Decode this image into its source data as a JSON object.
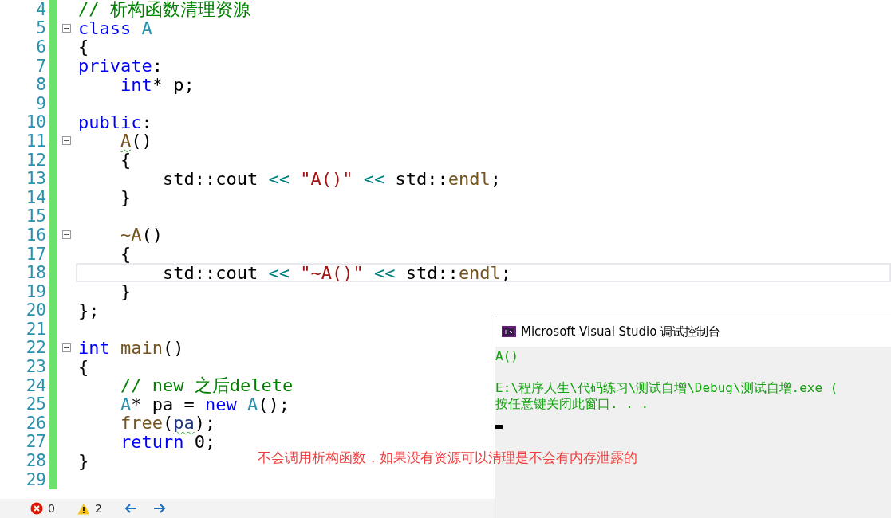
{
  "editor": {
    "lines": [
      {
        "number": "4",
        "tokens": [
          {
            "text": "// 析构函数清理资源",
            "kind": "comment"
          }
        ]
      },
      {
        "number": "5",
        "fold": true,
        "tokens": [
          {
            "text": "class",
            "kind": "keyword"
          },
          {
            "text": " A",
            "kind": "type"
          }
        ]
      },
      {
        "number": "6",
        "tokens": [
          {
            "text": "{"
          }
        ]
      },
      {
        "number": "7",
        "tokens": [
          {
            "text": "private",
            "kind": "keyword"
          },
          {
            "text": ":"
          }
        ]
      },
      {
        "number": "8",
        "tokens": [
          {
            "text": "    int",
            "kind": "keyword"
          },
          {
            "text": "* p;"
          }
        ]
      },
      {
        "number": "9"
      },
      {
        "number": "10",
        "tokens": [
          {
            "text": "public",
            "kind": "keyword"
          },
          {
            "text": ":"
          }
        ]
      },
      {
        "number": "11",
        "fold": true,
        "tokens": [
          {
            "text": "    A",
            "kind": "function",
            "squiggle": true
          },
          {
            "text": "()"
          }
        ]
      },
      {
        "number": "12",
        "tokens": [
          {
            "text": "    {"
          }
        ]
      },
      {
        "number": "13",
        "tokens": [
          {
            "text": "        std::cout "
          },
          {
            "text": "<< ",
            "kind": "operator"
          },
          {
            "text": "\"A()\" ",
            "kind": "string"
          },
          {
            "text": "<< ",
            "kind": "operator"
          },
          {
            "text": "std::"
          },
          {
            "text": "endl",
            "kind": "function"
          },
          {
            "text": ";"
          }
        ]
      },
      {
        "number": "14",
        "tokens": [
          {
            "text": "    }"
          }
        ]
      },
      {
        "number": "15"
      },
      {
        "number": "16",
        "fold": true,
        "tokens": [
          {
            "text": "    ~A",
            "kind": "function"
          },
          {
            "text": "()"
          }
        ]
      },
      {
        "number": "17",
        "tokens": [
          {
            "text": "    {"
          }
        ]
      },
      {
        "number": "18",
        "current": true,
        "tokens": [
          {
            "text": "        std::cout "
          },
          {
            "text": "<< ",
            "kind": "operator"
          },
          {
            "text": "\"~A()\" ",
            "kind": "string"
          },
          {
            "text": "<< ",
            "kind": "operator"
          },
          {
            "text": "std::"
          },
          {
            "text": "endl",
            "kind": "function"
          },
          {
            "text": ";"
          }
        ]
      },
      {
        "number": "19",
        "tokens": [
          {
            "text": "    }"
          }
        ]
      },
      {
        "number": "20",
        "tokens": [
          {
            "text": "};"
          }
        ]
      },
      {
        "number": "21"
      },
      {
        "number": "22",
        "fold": true,
        "tokens": [
          {
            "text": "int",
            "kind": "keyword"
          },
          {
            "text": " main",
            "kind": "function"
          },
          {
            "text": "()"
          }
        ]
      },
      {
        "number": "23",
        "tokens": [
          {
            "text": "{"
          }
        ]
      },
      {
        "number": "24",
        "tokens": [
          {
            "text": "    // new 之后delete",
            "kind": "comment"
          }
        ]
      },
      {
        "number": "25",
        "tokens": [
          {
            "text": "    A",
            "kind": "type"
          },
          {
            "text": "* pa = "
          },
          {
            "text": "new",
            "kind": "keyword"
          },
          {
            "text": " A",
            "kind": "type"
          },
          {
            "text": "();"
          }
        ]
      },
      {
        "number": "26",
        "tokens": [
          {
            "text": "    free",
            "kind": "function"
          },
          {
            "text": "("
          },
          {
            "text": "pa",
            "kind": "variable",
            "squiggle": true
          },
          {
            "text": ");"
          }
        ]
      },
      {
        "number": "27",
        "tokens": [
          {
            "text": "    return",
            "kind": "keyword"
          },
          {
            "text": " 0;"
          }
        ]
      },
      {
        "number": "28",
        "tokens": [
          {
            "text": "}"
          }
        ]
      },
      {
        "number": "29"
      }
    ]
  },
  "annotation": "不会调用析构函数，如果没有资源可以清理是不会有内存泄露的",
  "console": {
    "title": "Microsoft Visual Studio 调试控制台",
    "paragraphs": [
      [
        "A()"
      ],
      [
        "E:\\程序人生\\代码练习\\测试自增\\Debug\\测试自增.exe (",
        "按任意键关闭此窗口. . ."
      ]
    ]
  },
  "status_bar": {
    "errors": "0",
    "warnings": "2"
  }
}
